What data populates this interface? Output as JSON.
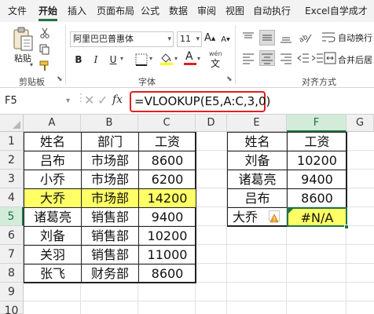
{
  "menu": {
    "tabs": [
      "文件",
      "开始",
      "插入",
      "页面布局",
      "公式",
      "数据",
      "审阅",
      "视图",
      "自动执行",
      "Excel自学成才"
    ],
    "active_index": 1
  },
  "ribbon": {
    "paste_label": "粘贴",
    "clipboard_label": "剪贴板",
    "font_name": "阿里巴巴普惠体",
    "font_size": "11",
    "font_group_label": "字体",
    "bold": "B",
    "italic": "I",
    "underline": "U",
    "font_color_glyph": "A",
    "wen_glyph": "wén",
    "increase_font": "A",
    "decrease_font": "A",
    "align_group_label": "对齐方式",
    "wrap_text": "自动换行",
    "merge_center": "合并后居",
    "accent_color": "#217346",
    "font_color_bar": "#e02020",
    "fill_color_bar": "#ffff00"
  },
  "formula_bar": {
    "name_box": "F5",
    "fx": "fx",
    "formula": "=VLOOKUP(E5,A:C,3,0)"
  },
  "sheet": {
    "columns": [
      "A",
      "B",
      "C",
      "D",
      "E",
      "F",
      "G"
    ],
    "rows": [
      "1",
      "2",
      "3",
      "4",
      "5",
      "6",
      "7",
      "8",
      "9",
      "10"
    ],
    "left_table": {
      "headers": [
        "姓名",
        "部门",
        "工资"
      ],
      "rows": [
        [
          "吕布",
          "市场部",
          "8600"
        ],
        [
          "小乔",
          "市场部",
          "6200"
        ],
        [
          "大乔",
          "市场部",
          "14200"
        ],
        [
          "诸葛亮",
          "销售部",
          "9400"
        ],
        [
          "刘备",
          "销售部",
          "10200"
        ],
        [
          "关羽",
          "销售部",
          "11000"
        ],
        [
          "张飞",
          "财务部",
          "8600"
        ]
      ],
      "highlight_row": 2,
      "highlight_color": "#ffff66"
    },
    "right_table": {
      "headers": [
        "姓名",
        "工资"
      ],
      "rows": [
        [
          "刘备",
          "10200"
        ],
        [
          "诸葛亮",
          "9400"
        ],
        [
          "吕布",
          "8600"
        ],
        [
          "大乔",
          "#N/A"
        ]
      ],
      "error_fill": "#ffff66"
    },
    "selected_cell": "F5"
  }
}
